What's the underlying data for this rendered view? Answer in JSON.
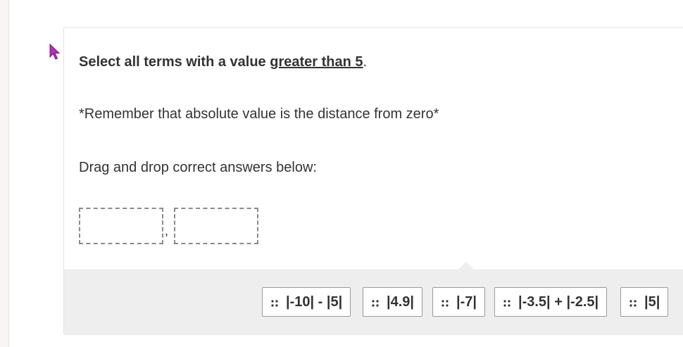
{
  "question": {
    "prompt_prefix": "Select all terms with a value ",
    "prompt_emphasis": "greater than 5",
    "prompt_suffix": ".",
    "note": "*Remember that absolute value is the distance from zero*",
    "instruction": "Drag and drop correct answers below:"
  },
  "answer_slots": {
    "separator": ","
  },
  "choices": [
    {
      "label": "|-10| - |5|"
    },
    {
      "label": "|4.9|"
    },
    {
      "label": "|-7|"
    },
    {
      "label": "|-3.5| + |-2.5|"
    },
    {
      "label": "|5|"
    }
  ],
  "icons": {
    "cursor": "mouse-pointer-icon",
    "grip": "drag-handle-icon"
  },
  "colors": {
    "cursor": "#b22fb4",
    "text": "#333333",
    "bank_background": "#eeeeee",
    "chip_border": "#9a9a9a"
  }
}
